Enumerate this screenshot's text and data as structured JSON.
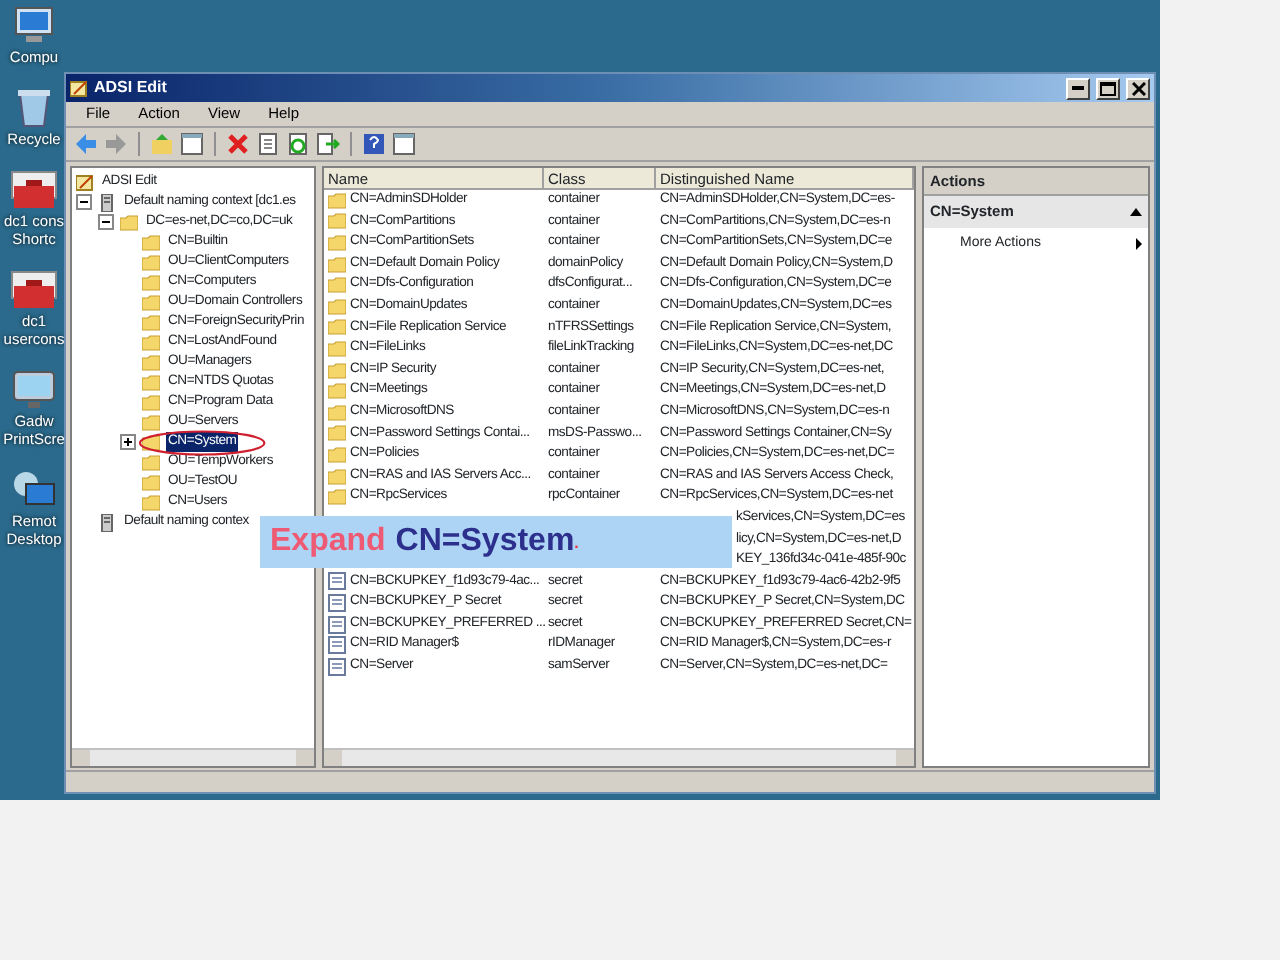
{
  "desktop_icons": [
    {
      "kind": "computer",
      "lines": [
        "Compu"
      ]
    },
    {
      "kind": "recycle",
      "lines": [
        "Recycle"
      ]
    },
    {
      "kind": "toolbox",
      "lines": [
        "dc1 cons",
        "Shortc"
      ]
    },
    {
      "kind": "toolbox",
      "lines": [
        "dc1",
        "usercons"
      ]
    },
    {
      "kind": "monitor",
      "lines": [
        "Gadw",
        "PrintScre"
      ]
    },
    {
      "kind": "remote",
      "lines": [
        "Remot",
        "Desktop"
      ]
    }
  ],
  "window": {
    "title": "ADSI Edit"
  },
  "menu": [
    "File",
    "Action",
    "View",
    "Help"
  ],
  "tree": [
    {
      "label": "ADSI Edit",
      "kind": "root",
      "children": [
        {
          "label": "Default naming context [dc1.es",
          "kind": "server",
          "expanded": true,
          "children": [
            {
              "label": "DC=es-net,DC=co,DC=uk",
              "kind": "folder",
              "expanded": true,
              "children": [
                {
                  "label": "CN=Builtin",
                  "kind": "folder",
                  "selected": false
                },
                {
                  "label": "OU=ClientComputers",
                  "kind": "folder",
                  "selected": false
                },
                {
                  "label": "CN=Computers",
                  "kind": "folder",
                  "selected": false
                },
                {
                  "label": "OU=Domain Controllers",
                  "kind": "folder",
                  "selected": false
                },
                {
                  "label": "CN=ForeignSecurityPrin",
                  "kind": "folder",
                  "selected": false
                },
                {
                  "label": "CN=LostAndFound",
                  "kind": "folder",
                  "selected": false
                },
                {
                  "label": "OU=Managers",
                  "kind": "folder",
                  "selected": false
                },
                {
                  "label": "CN=NTDS Quotas",
                  "kind": "folder",
                  "selected": false
                },
                {
                  "label": "CN=Program Data",
                  "kind": "folder",
                  "selected": false
                },
                {
                  "label": "OU=Servers",
                  "kind": "folder",
                  "selected": false
                },
                {
                  "label": "CN=System",
                  "kind": "folder",
                  "selected": true,
                  "expanded": false,
                  "circled": true
                },
                {
                  "label": "OU=TempWorkers",
                  "kind": "folder",
                  "selected": false
                },
                {
                  "label": "OU=TestOU",
                  "kind": "folder",
                  "selected": false
                },
                {
                  "label": "CN=Users",
                  "kind": "folder",
                  "selected": false
                }
              ]
            }
          ]
        },
        {
          "label": "Default naming contex",
          "kind": "server"
        }
      ]
    }
  ],
  "list": {
    "columns": [
      "Name",
      "Class",
      "Distinguished Name"
    ],
    "rows": [
      {
        "kind": "folder",
        "name": "CN=AdminSDHolder",
        "class": "container",
        "dn": "CN=AdminSDHolder,CN=System,DC=es-"
      },
      {
        "kind": "folder",
        "name": "CN=ComPartitions",
        "class": "container",
        "dn": "CN=ComPartitions,CN=System,DC=es-n"
      },
      {
        "kind": "folder",
        "name": "CN=ComPartitionSets",
        "class": "container",
        "dn": "CN=ComPartitionSets,CN=System,DC=e"
      },
      {
        "kind": "folder",
        "name": "CN=Default Domain Policy",
        "class": "domainPolicy",
        "dn": "CN=Default Domain Policy,CN=System,D"
      },
      {
        "kind": "folder",
        "name": "CN=Dfs-Configuration",
        "class": "dfsConfigurat...",
        "dn": "CN=Dfs-Configuration,CN=System,DC=e"
      },
      {
        "kind": "folder",
        "name": "CN=DomainUpdates",
        "class": "container",
        "dn": "CN=DomainUpdates,CN=System,DC=es"
      },
      {
        "kind": "folder",
        "name": "CN=File Replication Service",
        "class": "nTFRSSettings",
        "dn": "CN=File Replication Service,CN=System,"
      },
      {
        "kind": "folder",
        "name": "CN=FileLinks",
        "class": "fileLinkTracking",
        "dn": "CN=FileLinks,CN=System,DC=es-net,DC"
      },
      {
        "kind": "folder",
        "name": "CN=IP Security",
        "class": "container",
        "dn": "CN=IP Security,CN=System,DC=es-net,"
      },
      {
        "kind": "folder",
        "name": "CN=Meetings",
        "class": "container",
        "dn": "CN=Meetings,CN=System,DC=es-net,D"
      },
      {
        "kind": "folder",
        "name": "CN=MicrosoftDNS",
        "class": "container",
        "dn": "CN=MicrosoftDNS,CN=System,DC=es-n"
      },
      {
        "kind": "folder",
        "name": "CN=Password Settings Contai...",
        "class": "msDS-Passwo...",
        "dn": "CN=Password Settings Container,CN=Sy"
      },
      {
        "kind": "folder",
        "name": "CN=Policies",
        "class": "container",
        "dn": "CN=Policies,CN=System,DC=es-net,DC="
      },
      {
        "kind": "folder",
        "name": "CN=RAS and IAS Servers Acc...",
        "class": "container",
        "dn": "CN=RAS and IAS Servers Access Check,"
      },
      {
        "kind": "folder",
        "name": "CN=RpcServices",
        "class": "rpcContainer",
        "dn": "CN=RpcServices,CN=System,DC=es-net"
      },
      {
        "kind": "covered",
        "dn": "kServices,CN=System,DC=es"
      },
      {
        "kind": "covered",
        "dn": "licy,CN=System,DC=es-net,D"
      },
      {
        "kind": "covered",
        "dn": "KEY_136fd34c-041e-485f-90c"
      },
      {
        "kind": "secret",
        "name": "CN=BCKUPKEY_f1d93c79-4ac...",
        "class": "secret",
        "dn": "CN=BCKUPKEY_f1d93c79-4ac6-42b2-9f5"
      },
      {
        "kind": "secret",
        "name": "CN=BCKUPKEY_P Secret",
        "class": "secret",
        "dn": "CN=BCKUPKEY_P Secret,CN=System,DC"
      },
      {
        "kind": "secret",
        "name": "CN=BCKUPKEY_PREFERRED ...",
        "class": "secret",
        "dn": "CN=BCKUPKEY_PREFERRED Secret,CN="
      },
      {
        "kind": "secret",
        "name": "CN=RID Manager$",
        "class": "rIDManager",
        "dn": "CN=RID Manager$,CN=System,DC=es-r"
      },
      {
        "kind": "secret",
        "name": "CN=Server",
        "class": "samServer",
        "dn": "CN=Server,CN=System,DC=es-net,DC="
      }
    ]
  },
  "actions": {
    "title": "Actions",
    "section": "CN=System",
    "items": [
      "More Actions"
    ]
  },
  "callout": {
    "verb": "Expand",
    "target": "CN=System",
    "end": "."
  }
}
